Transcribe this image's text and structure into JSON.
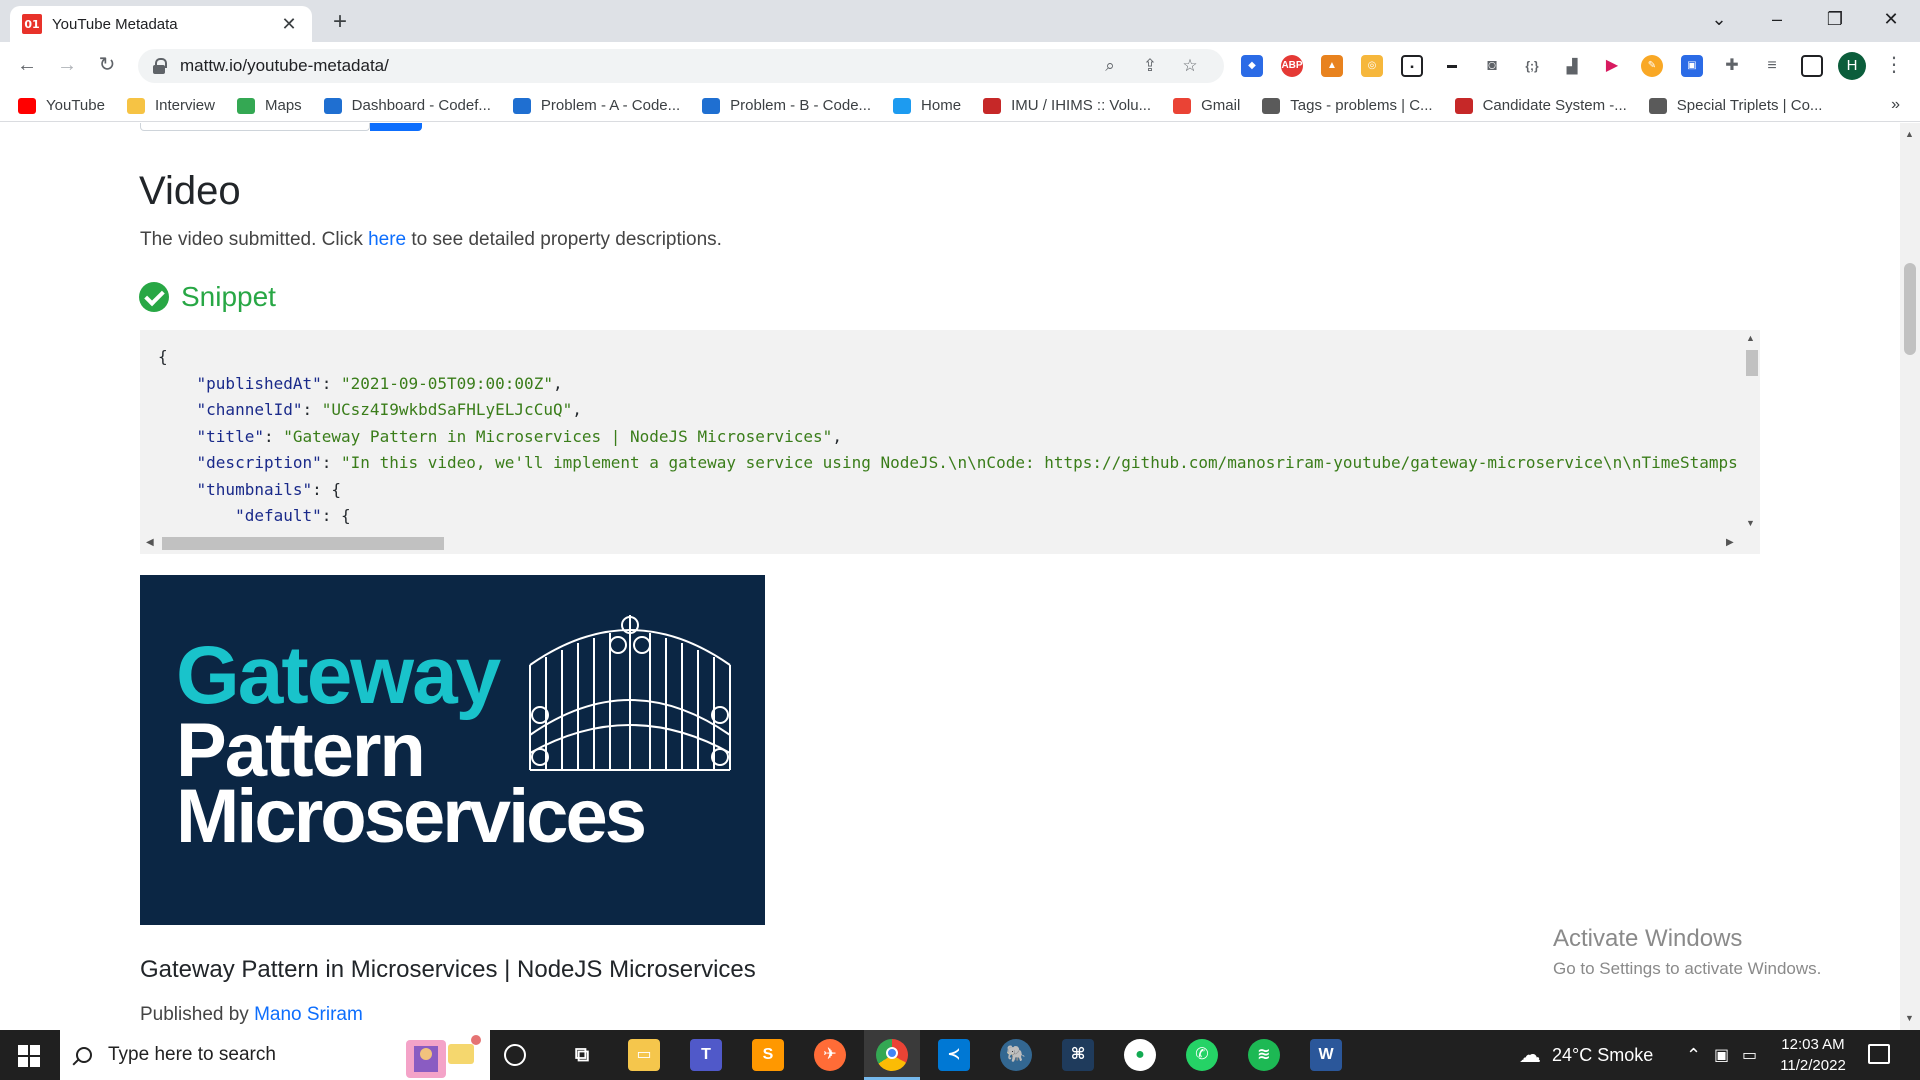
{
  "browser": {
    "tab": {
      "title": "YouTube Metadata",
      "favicon_text": "01"
    },
    "url": "mattw.io/youtube-metadata/",
    "profile_initial": "H",
    "bookmarks": [
      {
        "label": "YouTube",
        "color": "#ff0000"
      },
      {
        "label": "Interview",
        "color": "#f6c344"
      },
      {
        "label": "Maps",
        "color": "#34a853"
      },
      {
        "label": "Dashboard - Codef...",
        "color": "#1f6fd1"
      },
      {
        "label": "Problem - A - Code...",
        "color": "#1f6fd1"
      },
      {
        "label": "Problem - B - Code...",
        "color": "#1f6fd1"
      },
      {
        "label": "Home",
        "color": "#1d9bf0"
      },
      {
        "label": "IMU / IHIMS :: Volu...",
        "color": "#c62828"
      },
      {
        "label": "Gmail",
        "color": "#ea4335"
      },
      {
        "label": "Tags - problems | C...",
        "color": "#5a5a5a"
      },
      {
        "label": "Candidate System -...",
        "color": "#c62828"
      },
      {
        "label": "Special Triplets | Co...",
        "color": "#5a5a5a"
      }
    ],
    "bookmarks_overflow": "»"
  },
  "page": {
    "heading": "Video",
    "lead_before": "The video submitted. Click ",
    "lead_link": "here",
    "lead_after": " to see detailed property descriptions.",
    "section_title": "Snippet",
    "code_lines": [
      {
        "indent": "",
        "key": "",
        "value": "",
        "text": "{"
      },
      {
        "indent": "    ",
        "key": "\"publishedAt\"",
        "value": "\"2021-09-05T09:00:00Z\"",
        "trail": ","
      },
      {
        "indent": "    ",
        "key": "\"channelId\"",
        "value": "\"UCsz4I9wkbdSaFHLyELJcCuQ\"",
        "trail": ","
      },
      {
        "indent": "    ",
        "key": "\"title\"",
        "value": "\"Gateway Pattern in Microservices | NodeJS Microservices\"",
        "trail": ","
      },
      {
        "indent": "    ",
        "key": "\"description\"",
        "value": "\"In this video, we'll implement a gateway service using NodeJS.\\n\\nCode: https://github.com/manosriram-youtube/gateway-microservice\\n\\nTimeStamps",
        "trail": ""
      },
      {
        "indent": "    ",
        "key": "\"thumbnails\"",
        "value": "",
        "trail": " {"
      },
      {
        "indent": "        ",
        "key": "\"default\"",
        "value": "",
        "trail": " {"
      }
    ],
    "thumbnail": {
      "line1": "Gateway",
      "line2": "Pattern",
      "line3": "Microservices",
      "bg_color": "#0b2644",
      "accent_color": "#19c3cb"
    },
    "video_title": "Gateway Pattern in Microservices | NodeJS Microservices",
    "published_prefix": "Published by ",
    "channel_name": "Mano Sriram"
  },
  "watermark": {
    "line1": "Activate Windows",
    "line2": "Go to Settings to activate Windows."
  },
  "taskbar": {
    "search_placeholder": "Type here to search",
    "weather": "24°C  Smoke",
    "time": "12:03 AM",
    "date": "11/2/2022",
    "apps": [
      "cortana",
      "task-view",
      "file-explorer",
      "teams",
      "sublime-text",
      "postman",
      "chrome",
      "vscode",
      "postgresql",
      "mysql-workbench",
      "mongodb-compass",
      "whatsapp",
      "spotify",
      "word"
    ]
  }
}
